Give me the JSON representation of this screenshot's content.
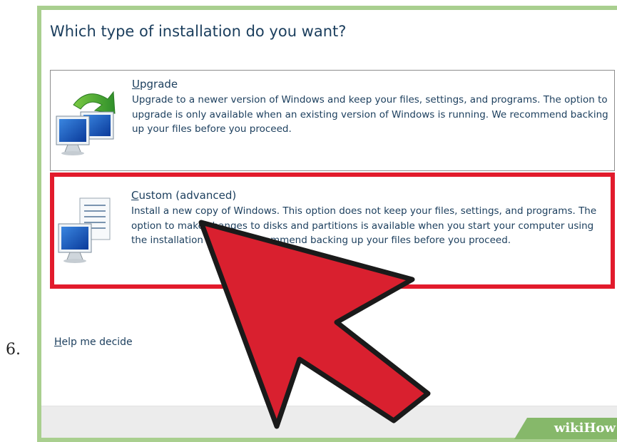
{
  "step": {
    "number": "6."
  },
  "dialog": {
    "title": "Which type of installation do you want?",
    "options": [
      {
        "accel": "U",
        "label_rest": "pgrade",
        "description": "Upgrade to a newer version of Windows and keep your files, settings, and programs. The option to upgrade is only available when an existing version of Windows is running. We recommend backing up your files before you proceed.",
        "icon": "upgrade-computer-icon"
      },
      {
        "accel": "C",
        "label_rest": "ustom (advanced)",
        "description": "Install a new copy of Windows. This option does not keep your files, settings, and programs. The option to make changes to disks and partitions is available when you start your computer using the installation disc. We recommend backing up your files before you proceed.",
        "icon": "custom-install-computer-icon",
        "highlighted": true
      }
    ],
    "help_link": {
      "accel": "H",
      "rest": "elp me decide"
    }
  },
  "watermark": {
    "brand": "wikiHow"
  },
  "colors": {
    "frame_green": "#a9cf8f",
    "highlight_red": "#e21b2c",
    "text_blue": "#1b3e5d",
    "arrow_red": "#d9202f"
  }
}
